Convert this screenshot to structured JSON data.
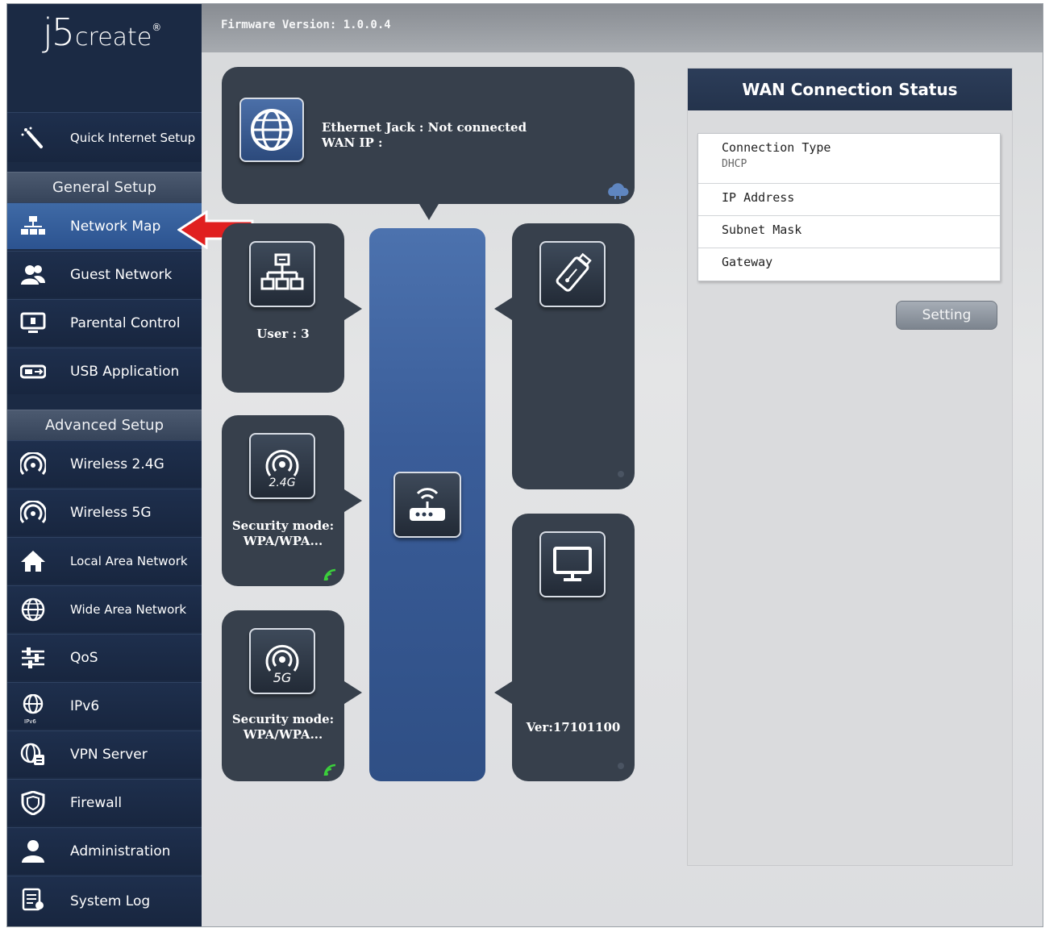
{
  "brand": {
    "logo_main": "j5",
    "logo_tail": "create",
    "logo_mark": "®"
  },
  "firmware": "Firmware Version: 1.0.0.4",
  "sidebar": {
    "quick_setup": "Quick Internet Setup",
    "general_header": "General Setup",
    "general_items": [
      {
        "label": "Network Map",
        "icon": "network-map-icon",
        "active": true
      },
      {
        "label": "Guest Network",
        "icon": "guest-users-icon"
      },
      {
        "label": "Parental Control",
        "icon": "parental-control-icon"
      },
      {
        "label": "USB Application",
        "icon": "usb-drive-icon"
      }
    ],
    "advanced_header": "Advanced Setup",
    "advanced_items": [
      {
        "label": "Wireless 2.4G",
        "icon": "wireless-icon"
      },
      {
        "label": "Wireless 5G",
        "icon": "wireless-icon"
      },
      {
        "label": "Local Area Network",
        "icon": "home-icon"
      },
      {
        "label": "Wide Area Network",
        "icon": "globe-icon"
      },
      {
        "label": "QoS",
        "icon": "qos-sliders-icon"
      },
      {
        "label": "IPv6",
        "icon": "ipv6-globe-icon",
        "icon_text": "IPv6"
      },
      {
        "label": "VPN Server",
        "icon": "vpn-server-icon"
      },
      {
        "label": "Firewall",
        "icon": "shield-icon"
      },
      {
        "label": "Administration",
        "icon": "admin-user-icon"
      },
      {
        "label": "System Log",
        "icon": "log-document-icon"
      }
    ]
  },
  "map": {
    "internet": {
      "line1": "Ethernet Jack : Not connected",
      "line2": "WAN IP :"
    },
    "clients": {
      "label": "User : 3"
    },
    "wifi24": {
      "badge": "2.4G",
      "security": "Security mode:",
      "security_value": "WPA/WPA..."
    },
    "wifi5": {
      "badge": "5G",
      "security": "Security mode:",
      "security_value": "WPA/WPA..."
    },
    "device": {
      "version": "Ver:17101100"
    }
  },
  "wan_status": {
    "title": "WAN Connection Status",
    "rows": [
      {
        "label": "Connection Type",
        "value": "DHCP"
      },
      {
        "label": "IP Address",
        "value": ""
      },
      {
        "label": "Subnet Mask",
        "value": ""
      },
      {
        "label": "Gateway",
        "value": ""
      }
    ],
    "setting_button": "Setting"
  },
  "colors": {
    "sidebar_bg": "#1b2a44",
    "active_item": "#3f6aa6",
    "panel_bg": "#37404c",
    "pointer_arrow": "#e02020",
    "router_column": "#3b5f9c"
  }
}
